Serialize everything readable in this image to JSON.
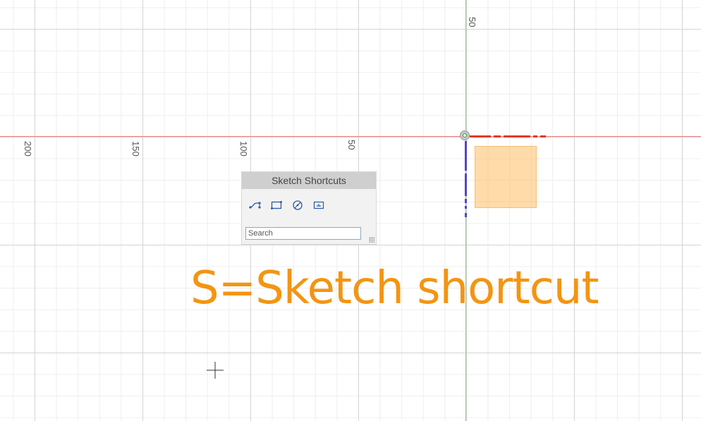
{
  "rulers": {
    "horizontal": [
      "200",
      "150",
      "100",
      "50"
    ],
    "vertical": [
      "50"
    ]
  },
  "sketch_panel": {
    "title": "Sketch Shortcuts",
    "icons": [
      "spline-icon",
      "rectangle-icon",
      "circle-icon",
      "dimension-icon"
    ],
    "search_placeholder": "Search"
  },
  "overlay_caption": "S=Sketch shortcut",
  "colors": {
    "x_axis": "#f08080",
    "y_axis": "#7fd67f",
    "sketch_red": "#e23b1c",
    "sketch_blue": "#5543c9",
    "plane_fill": "#ffbe64",
    "caption": "#f39512"
  }
}
